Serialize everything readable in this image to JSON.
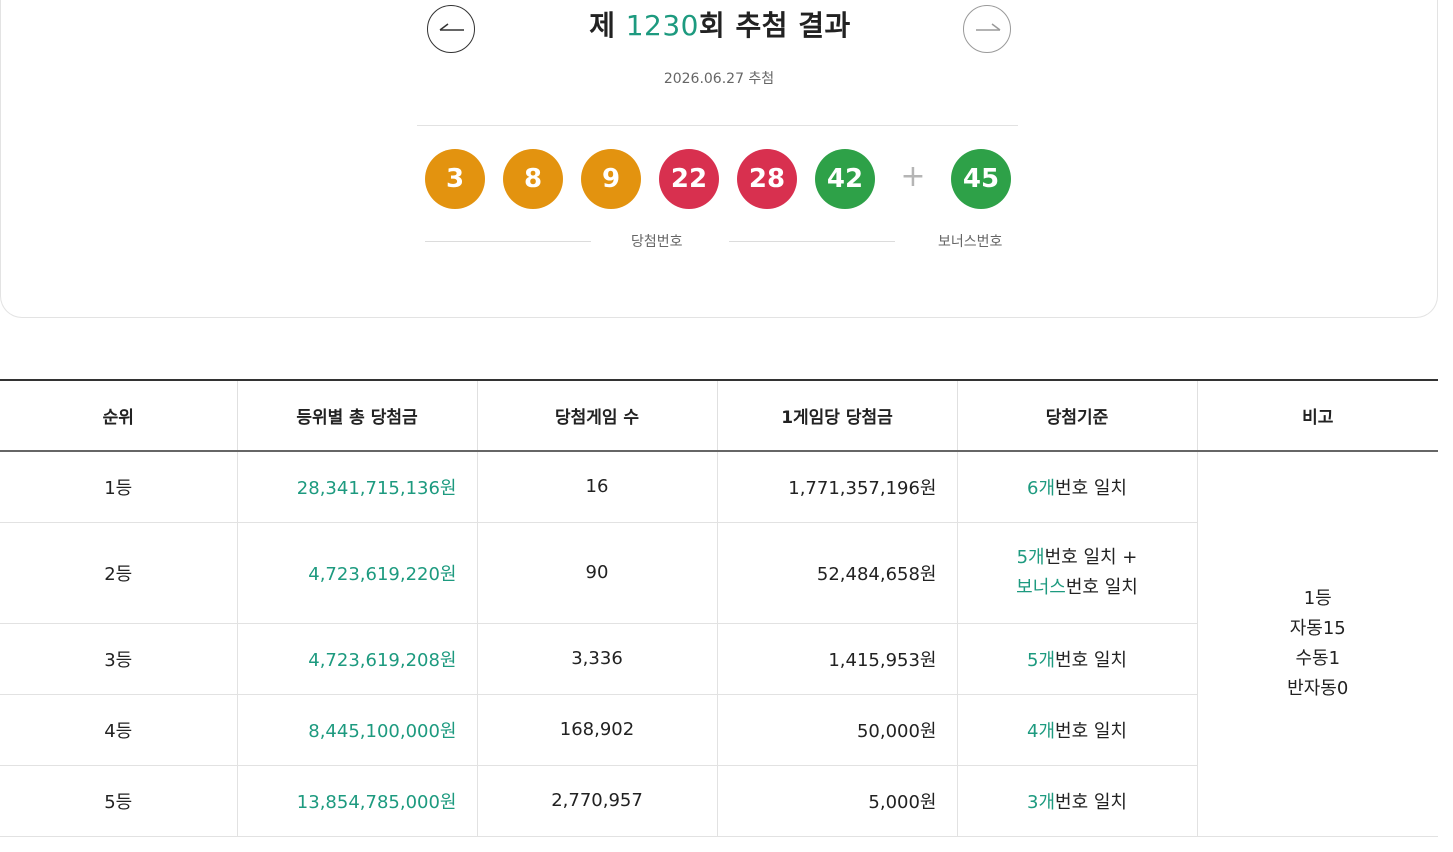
{
  "draw": {
    "title_prefix": "제 ",
    "round_number": "1230",
    "title_suffix": "회 추첨 결과",
    "date_text": "2026.06.27 추첨"
  },
  "balls": [
    {
      "value": "3",
      "color": "orange"
    },
    {
      "value": "8",
      "color": "orange"
    },
    {
      "value": "9",
      "color": "orange"
    },
    {
      "value": "22",
      "color": "red"
    },
    {
      "value": "28",
      "color": "red"
    },
    {
      "value": "42",
      "color": "green"
    }
  ],
  "bonus_ball": {
    "value": "45",
    "color": "green"
  },
  "plus_sign": "+",
  "labels": {
    "winning_numbers": "당첨번호",
    "bonus_number": "보너스번호"
  },
  "colors": {
    "accent": "#1d9a7f",
    "ball_orange": "#e3930f",
    "ball_red": "#d8304f",
    "ball_green": "#2ea148"
  },
  "table": {
    "headers": [
      "순위",
      "등위별 총 당첨금",
      "당첨게임 수",
      "1게임당 당첨금",
      "당첨기준",
      "비고"
    ],
    "rows": [
      {
        "rank": "1등",
        "total": "28,341,715,136원",
        "games": "16",
        "per_game": "1,771,357,196원",
        "criteria_count": "6개",
        "criteria_text": "번호 일치"
      },
      {
        "rank": "2등",
        "total": "4,723,619,220원",
        "games": "90",
        "per_game": "52,484,658원",
        "criteria_count": "5개",
        "criteria_text": "번호 일치 +",
        "criteria_bonus": "보너스",
        "criteria_bonus_text": "번호 일치"
      },
      {
        "rank": "3등",
        "total": "4,723,619,208원",
        "games": "3,336",
        "per_game": "1,415,953원",
        "criteria_count": "5개",
        "criteria_text": "번호 일치"
      },
      {
        "rank": "4등",
        "total": "8,445,100,000원",
        "games": "168,902",
        "per_game": "50,000원",
        "criteria_count": "4개",
        "criteria_text": "번호 일치"
      },
      {
        "rank": "5등",
        "total": "13,854,785,000원",
        "games": "2,770,957",
        "per_game": "5,000원",
        "criteria_count": "3개",
        "criteria_text": "번호 일치"
      }
    ],
    "note_lines": [
      "1등",
      "자동15",
      "수동1",
      "반자동0"
    ]
  }
}
